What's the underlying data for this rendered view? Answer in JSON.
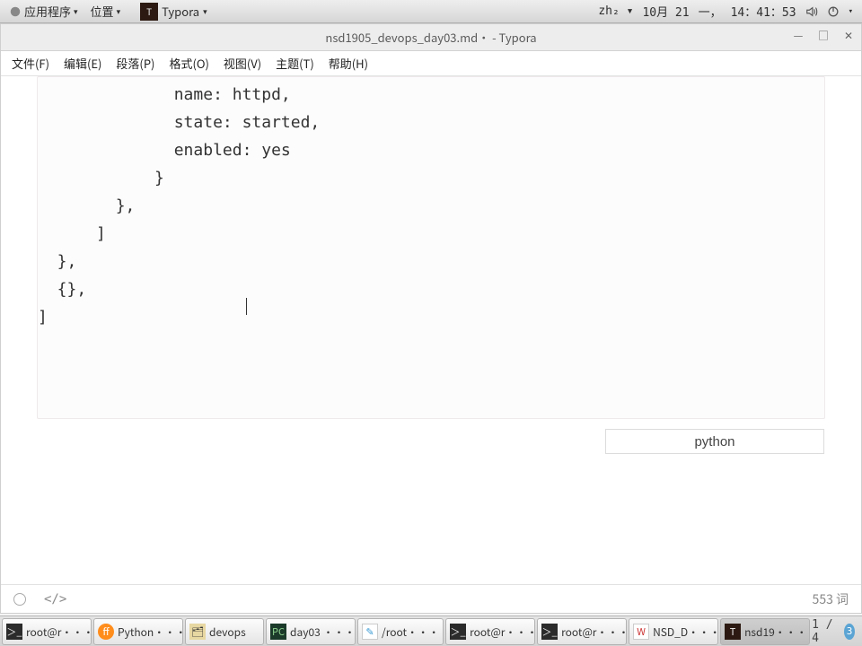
{
  "panel": {
    "apps_menu": "应用程序",
    "places_menu": "位置",
    "current_app": "Typora",
    "input_method": "zh₂",
    "date": "10月 21",
    "weekday": "一，",
    "time": "14：41：53"
  },
  "window": {
    "title": "nsd1905_devops_day03.md• - Typora",
    "menus": {
      "file": "文件(F)",
      "edit": "编辑(E)",
      "paragraph": "段落(P)",
      "format": "格式(O)",
      "view": "视图(V)",
      "theme": "主题(T)",
      "help": "帮助(H)"
    }
  },
  "code": {
    "line1": "              name: httpd,",
    "line2": "              state: started,",
    "line3": "              enabled: yes",
    "line4": "            }",
    "line5": "        },",
    "line6": "      ]",
    "line7": "  },",
    "line8": "  {},",
    "line9": "]",
    "language": "python"
  },
  "statusbar": {
    "code_toggle": "</>",
    "words": "553 词"
  },
  "taskbar": {
    "items": [
      "root@r···",
      "Python···",
      "devops",
      "day03 ···",
      "/root···",
      "root@r···",
      "root@r···",
      "NSD_D···",
      "nsd19···"
    ],
    "pager": "1  /  4",
    "workspace_badge": "3"
  }
}
